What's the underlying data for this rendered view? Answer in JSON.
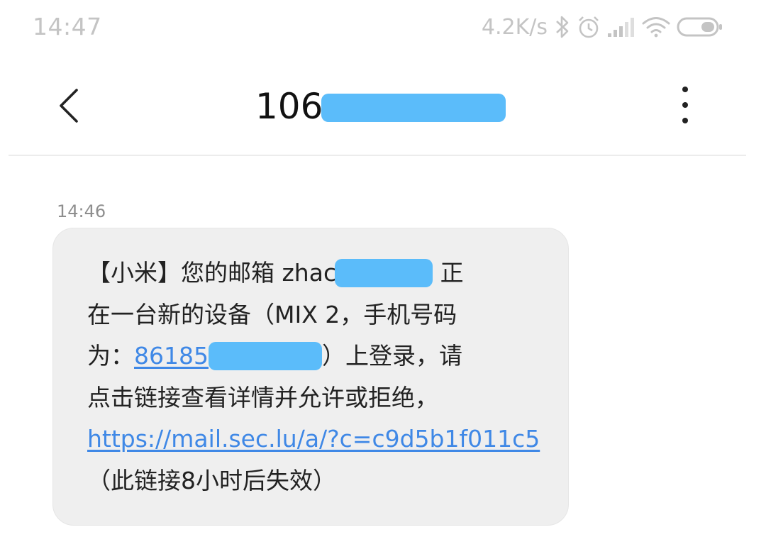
{
  "status_bar": {
    "time": "14:47",
    "net_speed": "4.2K/s",
    "icons": [
      "bluetooth-icon",
      "alarm-icon",
      "signal-icon",
      "wifi-icon",
      "battery-icon"
    ]
  },
  "header": {
    "title_visible": "106",
    "back_icon": "chevron-left-icon",
    "menu_icon": "more-vertical-icon",
    "redaction_color": "#5bbcfa"
  },
  "message": {
    "timestamp": "14:46",
    "line1_prefix": "【小米】您的邮箱 zhac",
    "line1_suffix": "正",
    "line2": "在一台新的设备（MIX 2，手机号码",
    "line3_prefix": "为：",
    "line3_phone_visible": "86185",
    "line3_suffix": "）上登录，请",
    "line4": "点击链接查看详情并允许或拒绝，",
    "link": "https://mail.sec.lu/a/?c=c9d5b1f011c5",
    "line6": "（此链接8小时后失效）",
    "link_color": "#3f88e6",
    "bubble_color": "#efefef"
  }
}
